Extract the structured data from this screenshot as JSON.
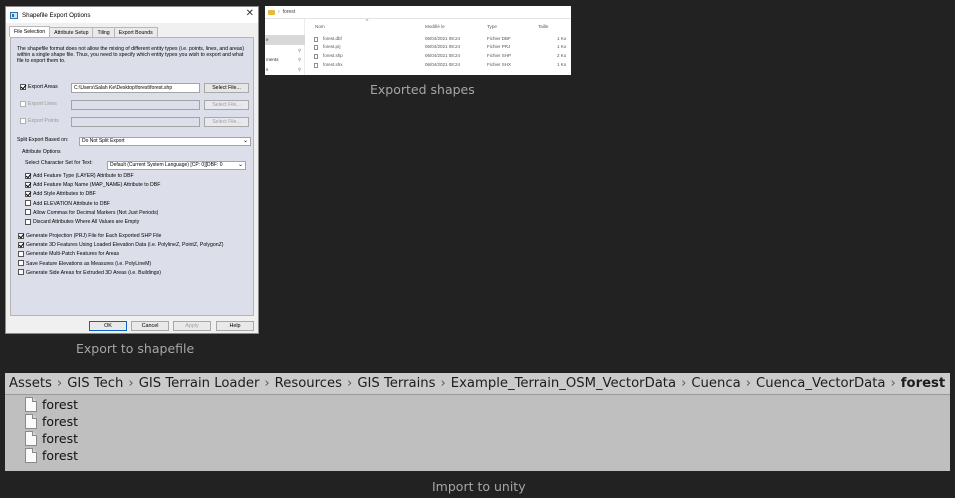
{
  "dialog": {
    "title": "Shapefile Export Options",
    "tabs": [
      "File Selection",
      "Attribute Setup",
      "Tiling",
      "Export Bounds"
    ],
    "description": "The shapefile format does not allow the mixing of different entity types (i.e. points, lines, and areas) within a single shape file. Thus, you need to specify which entity types you wish to export and what file to export them to.",
    "export_areas": {
      "label": "Export Areas",
      "checked": true,
      "path": "C:\\Users\\Salah Ke\\Desktop\\forest\\forest.shp",
      "button": "Select File..."
    },
    "export_lines": {
      "label": "Export Lines",
      "checked": false,
      "path": "",
      "button": "Select File..."
    },
    "export_points": {
      "label": "Export Points",
      "checked": false,
      "path": "",
      "button": "Select File..."
    },
    "split_label": "Split Export Based on:",
    "split_value": "Do Not Split Export",
    "attr_group": "Attribute Options",
    "charset_label": "Select Character Set for Text:",
    "charset_value": "Default (Current System Language) [CP: 0][DBF: 0",
    "attr_options": [
      {
        "label": "Add Feature Type (LAYER) Attribute to DBF",
        "checked": true
      },
      {
        "label": "Add Feature Map Name (MAP_NAME) Attribute to DBF",
        "checked": true
      },
      {
        "label": "Add Style Attributes to DBF",
        "checked": true
      },
      {
        "label": "Add ELEVATION Attribute to DBF",
        "checked": false
      },
      {
        "label": "Allow Commas for Decimal Markers (Not Just Periods)",
        "checked": false
      },
      {
        "label": "Discard Attributes Where All Values are Empty",
        "checked": false
      }
    ],
    "gen_options": [
      {
        "label": "Generate Projection (PRJ) File for Each Exported SHP File",
        "checked": true
      },
      {
        "label": "Generate 3D Features Using Loaded Elevation Data (i.e. PolylineZ, PointZ, PolygonZ)",
        "checked": true
      },
      {
        "label": "Generate Multi-Patch Features for Areas",
        "checked": false
      },
      {
        "label": "Save Feature Elevations as Measures (i.e. PolyLineM)",
        "checked": false
      },
      {
        "label": "Generate Side Areas for Extruded 3D Areas (i.e. Buildings)",
        "checked": false
      }
    ],
    "buttons": {
      "ok": "OK",
      "cancel": "Cancel",
      "apply": "Apply",
      "help": "Help"
    }
  },
  "explorer": {
    "breadcrumb": "forest",
    "nav": [
      "e",
      "ments",
      "s"
    ],
    "headers": {
      "name": "Nom",
      "modified": "Modifié le",
      "type": "Type",
      "size": "Taille"
    },
    "files": [
      {
        "name": "forest.dbf",
        "date": "06/04/2021 08:24",
        "type": "Fichier DBF",
        "size": "1 Ko"
      },
      {
        "name": "forest.prj",
        "date": "06/04/2021 08:24",
        "type": "Fichier PRJ",
        "size": "1 Ko"
      },
      {
        "name": "forest.shp",
        "date": "06/04/2021 08:24",
        "type": "Fichier SHP",
        "size": "2 Ko"
      },
      {
        "name": "forest.shx",
        "date": "06/04/2021 08:24",
        "type": "Fichier SHX",
        "size": "1 Ko"
      }
    ]
  },
  "captions": {
    "exported": "Exported shapes",
    "export": "Export to shapefile",
    "import": "Import to unity"
  },
  "unity": {
    "breadcrumb": [
      "Assets",
      "GIS Tech",
      "GIS Terrain Loader",
      "Resources",
      "GIS Terrains",
      "Example_Terrain_OSM_VectorData",
      "Cuenca",
      "Cuenca_VectorData",
      "forest"
    ],
    "items": [
      "forest",
      "forest",
      "forest",
      "forest"
    ]
  }
}
